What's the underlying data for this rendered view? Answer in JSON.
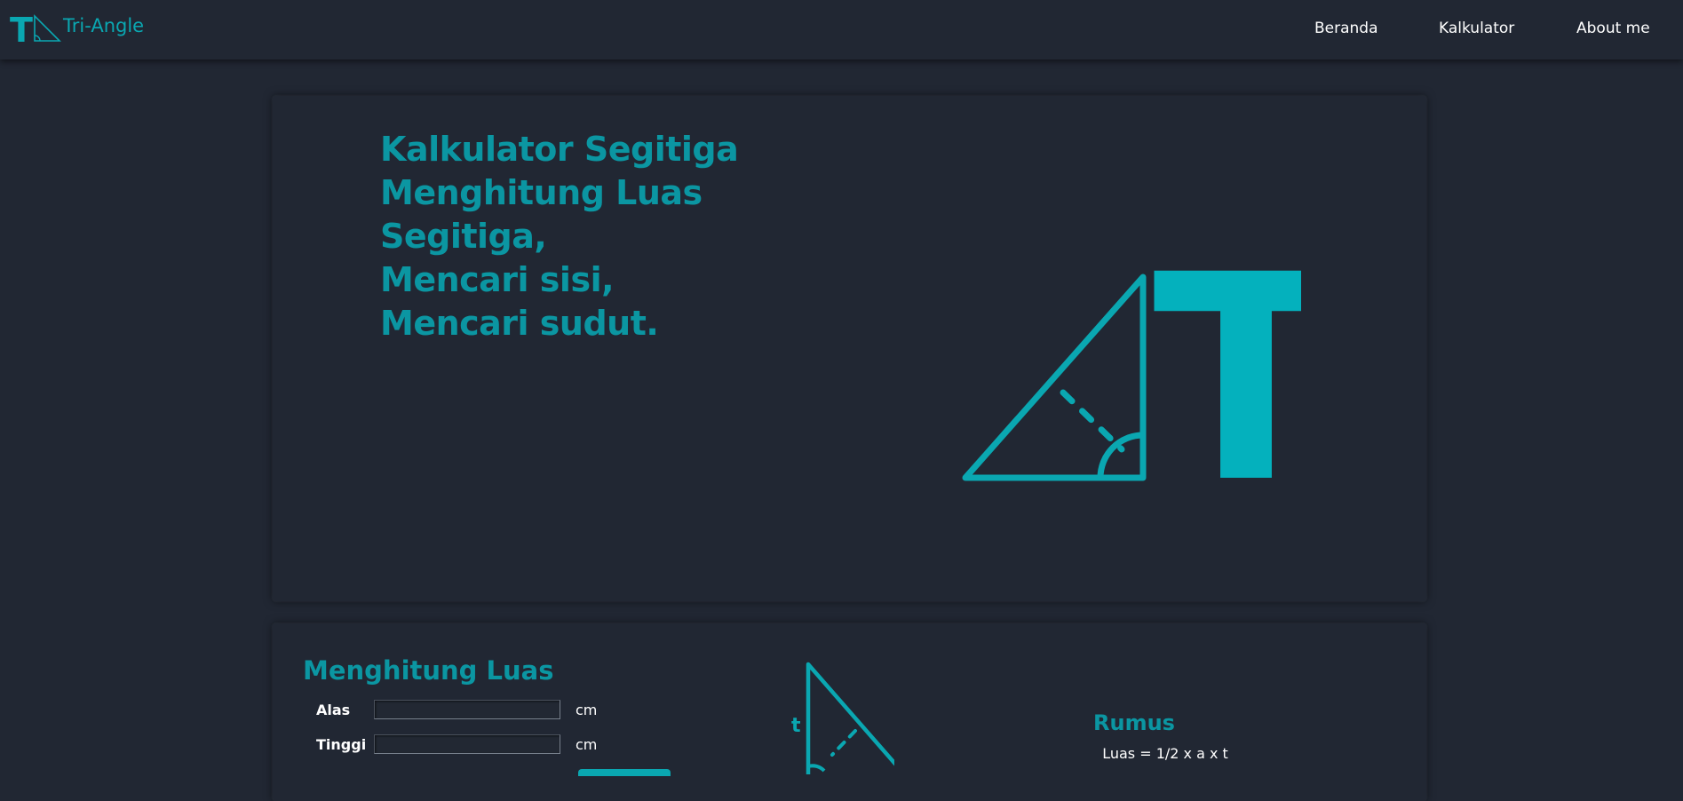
{
  "brand": {
    "name": "Tri-Angle",
    "logo_letter": "T"
  },
  "nav": {
    "items": [
      {
        "label": "Beranda"
      },
      {
        "label": "Kalkulator"
      },
      {
        "label": "About me"
      }
    ]
  },
  "hero": {
    "lines": [
      "Kalkulator Segitiga",
      "Menghitung Luas",
      "Segitiga,",
      "Mencari sisi,",
      "Mencari sudut."
    ],
    "logo_letter": "T"
  },
  "luas": {
    "title": "Menghitung Luas",
    "fields": [
      {
        "label": "Alas",
        "value": "",
        "unit": "cm"
      },
      {
        "label": "Tinggi",
        "value": "",
        "unit": "cm"
      }
    ],
    "figure_label": "t",
    "formula_title": "Rumus",
    "formula": "Luas = 1/2 x a x t"
  },
  "colors": {
    "background": "#212733",
    "accent": "#0aa7b1",
    "heading": "#0b96a2",
    "text": "#ffffff"
  }
}
